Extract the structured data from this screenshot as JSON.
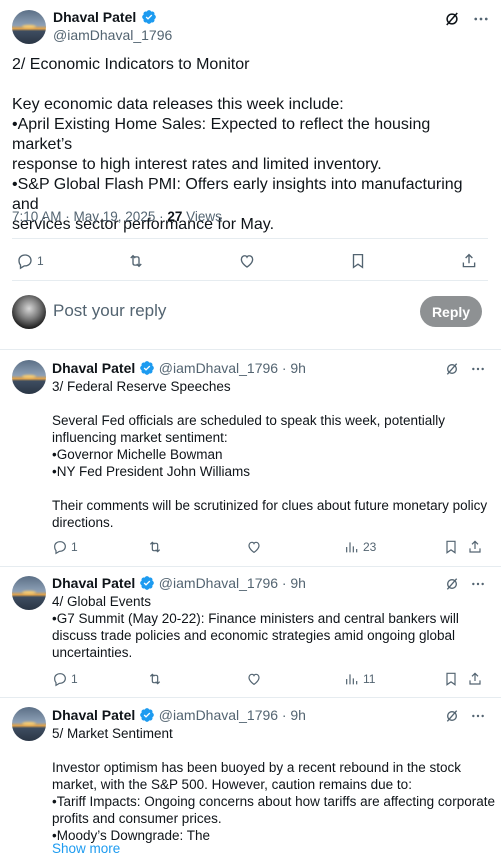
{
  "main_post": {
    "author_name": "Dhaval Patel",
    "author_handle": "@iamDhaval_1796",
    "text": "2/ Economic Indicators to Monitor\n\nKey economic data releases this week include:\n•April Existing Home Sales: Expected to reflect the housing market’s\nresponse to high interest rates and limited inventory.\n•S&P Global Flash PMI: Offers early insights into manufacturing and\nservices sector performance for May.",
    "time": "7:10 AM · May 19, 2025 · ",
    "views_count": "27",
    "views_label": " Views",
    "reply_count": "1"
  },
  "compose": {
    "placeholder": "Post your reply",
    "button_label": "Reply"
  },
  "replies": [
    {
      "author_name": "Dhaval Patel",
      "author_handle": "@iamDhaval_1796",
      "age": "· 9h",
      "text": "3/ Federal Reserve Speeches\n\nSeveral Fed officials are scheduled to speak this week, potentially\ninfluencing market sentiment:\n•Governor Michelle Bowman\n•NY Fed President John Williams\n\nTheir comments will be scrutinized for clues about future monetary policy\ndirections.",
      "reply_count": "1",
      "views": "23"
    },
    {
      "author_name": "Dhaval Patel",
      "author_handle": "@iamDhaval_1796",
      "age": "· 9h",
      "text": "4/ Global Events\n•G7 Summit (May 20-22): Finance ministers and central bankers will\ndiscuss trade policies and economic strategies amid ongoing global\nuncertainties.",
      "reply_count": "1",
      "views": "11"
    },
    {
      "author_name": "Dhaval Patel",
      "author_handle": "@iamDhaval_1796",
      "age": "· 9h",
      "text": "5/ Market Sentiment\n\nInvestor optimism has been buoyed by a recent rebound in the stock\nmarket, with the S&P 500. However, caution remains due to:\n•Tariff Impacts: Ongoing concerns about how tariffs are affecting corporate\nprofits and consumer prices.\n•Moody’s Downgrade: The",
      "show_more": "Show more"
    }
  ],
  "colors": {
    "accent": "#1d9bf0",
    "text": "#0f1419",
    "muted": "#536471",
    "divider": "#e6ecf0",
    "reply_button": "#8e9193"
  },
  "icons": [
    "verified-badge-icon",
    "grok-icon",
    "more-icon",
    "reply-icon",
    "repost-icon",
    "like-icon",
    "bookmark-icon",
    "share-icon",
    "views-icon"
  ]
}
